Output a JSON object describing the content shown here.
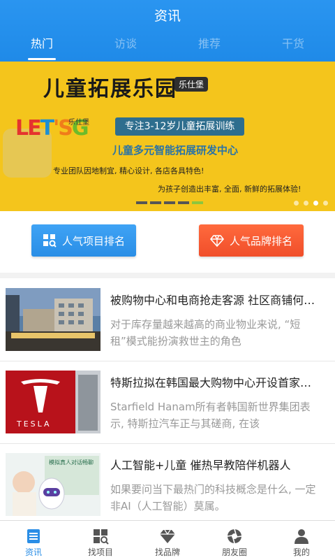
{
  "header": {
    "title": "资讯",
    "tabs": [
      "热门",
      "访谈",
      "推荐",
      "干货"
    ],
    "active_tab": 0
  },
  "banner": {
    "title": "儿童拓展乐园",
    "brand_badge": "乐仕堡",
    "logo_letters": [
      "LE",
      "T",
      "'S",
      "G"
    ],
    "logo_sub": "乐仕堡",
    "pill": "专注3-12岁儿童拓展训练",
    "line": "儿童多元智能拓展研发中心",
    "desc1": "专业团队因地制宜, 精心设计, 各店各具特色!",
    "desc2": "为孩子创造出丰富, 全面, 新鲜的拓展体验!",
    "dots_count": 4,
    "active_dot": 2
  },
  "buttons": {
    "left": "人气项目排名",
    "right": "人气品牌排名"
  },
  "articles": [
    {
      "title": "被购物中心和电商抢走客源 社区商铺何去何从",
      "summary": "对于库存量越来越高的商业物业来说, “短租”模式能扮演救世主的角色"
    },
    {
      "title": "特斯拉拟在韩国最大购物中心开设首家门店",
      "summary": "Starfield Hanam所有者韩国新世界集团表示, 特斯拉汽车正与其磋商, 在该"
    },
    {
      "title": "人工智能+儿童 催热早教陪伴机器人",
      "summary": "如果要问当下最热门的科技概念是什么, 一定非AI（人工智能）莫属。"
    }
  ],
  "thumb_texts": {
    "tesla": "TESLA",
    "robot_banner": "模拟真人对话畅聊"
  },
  "tabbar": {
    "items": [
      "资讯",
      "找项目",
      "找品牌",
      "朋友圈",
      "我的"
    ],
    "active": 0
  },
  "colors": {
    "primary": "#2a8ee6",
    "accent_red": "#f04e2a",
    "banner_yellow": "#f4c51c"
  }
}
